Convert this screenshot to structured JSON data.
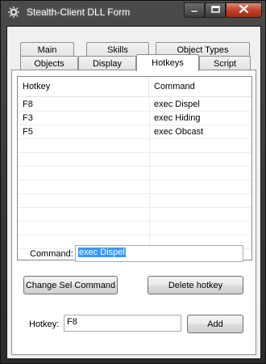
{
  "window": {
    "title": "Stealth-Client DLL Form"
  },
  "tabs": {
    "row_top": [
      "Main",
      "Skills",
      "Object Types"
    ],
    "row_bottom": [
      "Objects",
      "Display",
      "Hotkeys",
      "Script"
    ],
    "active": "Hotkeys"
  },
  "hotkeys_table": {
    "columns": [
      "Hotkey",
      "Command"
    ],
    "rows": [
      {
        "hotkey": "F8",
        "command": "exec Dispel"
      },
      {
        "hotkey": "F3",
        "command": "exec Hiding"
      },
      {
        "hotkey": "F5",
        "command": "exec Obcast"
      }
    ]
  },
  "command": {
    "label": "Command:",
    "value": "exec Dispel"
  },
  "buttons": {
    "change_sel_command": "Change Sel Command",
    "delete_hotkey": "Delete hotkey",
    "add": "Add"
  },
  "hotkey_field": {
    "label": "Hotkey:",
    "value": "F8"
  },
  "icons": {
    "app": "gear-icon",
    "minimize": "minimize-icon",
    "maximize": "maximize-icon",
    "close": "close-icon"
  },
  "colors": {
    "selection": "#3399ff",
    "close_button": "#c0432a"
  }
}
